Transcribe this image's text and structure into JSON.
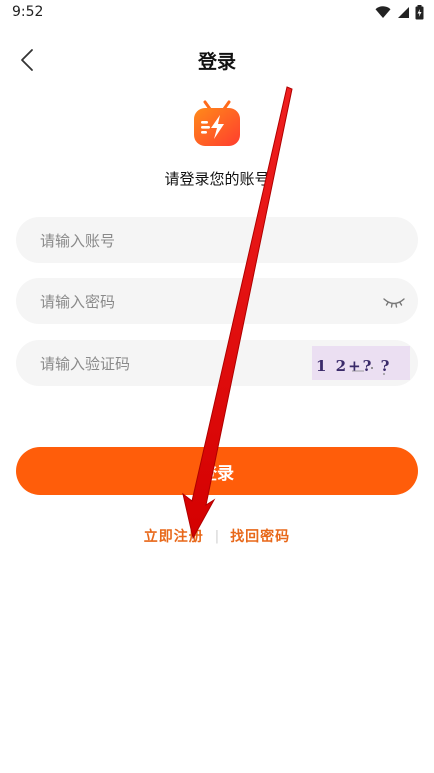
{
  "status_bar": {
    "time": "9:52"
  },
  "header": {
    "title": "登录"
  },
  "prompt": "请登录您的账号",
  "form": {
    "account_placeholder": "请输入账号",
    "password_placeholder": "请输入密码",
    "captcha_placeholder": "请输入验证码",
    "captcha_text": "1 2+? ?"
  },
  "login_label": "登录",
  "links": {
    "register": "立即注册",
    "separator": "|",
    "forgot": "找回密码"
  },
  "colors": {
    "accent": "#ff5d0a",
    "link": "#e8681a",
    "annotation_arrow": "#e00000"
  },
  "icons": {
    "back": "chevron-left-icon",
    "password_toggle": "eye-closed-icon",
    "logo": "tv-lightning-icon"
  }
}
